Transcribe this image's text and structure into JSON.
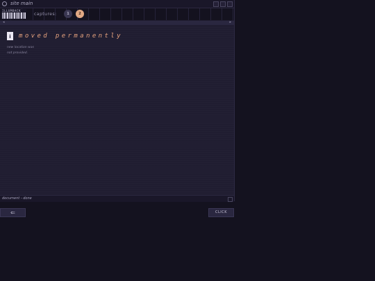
{
  "window": {
    "title": "site main"
  },
  "logo": {
    "wordmark": "ILLUMBACK"
  },
  "toolbar": {
    "captures_label": "captures:",
    "captures": [
      {
        "label": "1",
        "active": false
      },
      {
        "label": "2",
        "active": true
      }
    ]
  },
  "addrbar": {
    "left_glyph": "◂",
    "right_glyph": "▸"
  },
  "content": {
    "badge": "i",
    "heading": "moved permanently",
    "line1": "new location was",
    "line2": "not provided."
  },
  "status": {
    "text": "document - done"
  },
  "nav": {
    "back_label": "⇐",
    "click_label": "CLICK"
  },
  "colors": {
    "accent": "#e6a27e",
    "capture_active": "#e2a984",
    "background": "#14121f",
    "panel": "#201d31"
  }
}
